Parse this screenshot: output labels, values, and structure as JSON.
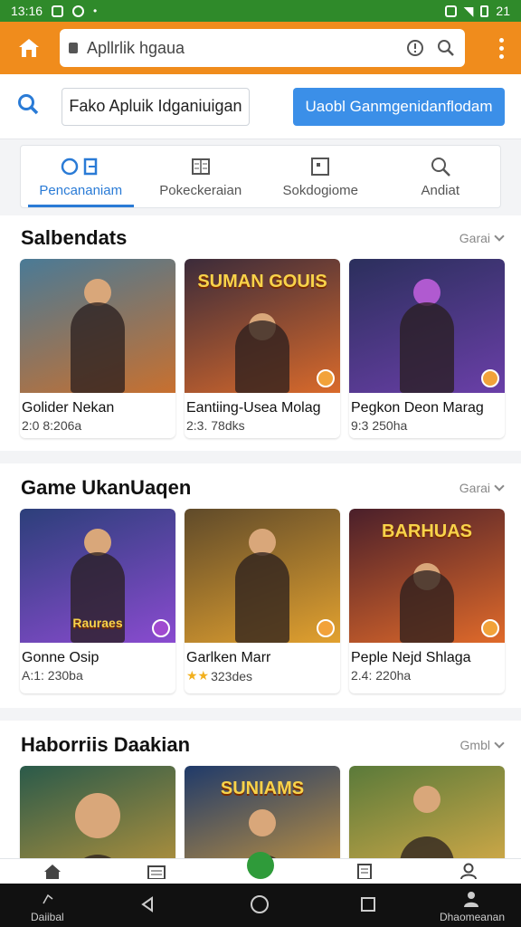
{
  "status_bar": {
    "time": "13:16",
    "battery": "21"
  },
  "app_bar": {
    "url": "Apllrlik hgaua"
  },
  "search": {
    "input_value": "Fako Apluik Idganiuigan",
    "button_label": "Uaobl Ganmgenidanflodam"
  },
  "tabs": [
    {
      "label": "Pencananiam",
      "icon": "tag-icon",
      "active": true
    },
    {
      "label": "Pokeckeraian",
      "icon": "list-icon",
      "active": false
    },
    {
      "label": "Sokdogiome",
      "icon": "grid-icon",
      "active": false
    },
    {
      "label": "Andiat",
      "icon": "search-icon",
      "active": false
    }
  ],
  "sections": [
    {
      "title": "Salbendats",
      "more_label": "Garai",
      "items": [
        {
          "name": "Golider Nekan",
          "meta": "2:0 8:206a",
          "logo": "",
          "colors": [
            "#4a7a96",
            "#c8702f"
          ]
        },
        {
          "name": "Eantiing-Usea Molag",
          "meta": "2:3. 78dks",
          "logo": "SUMAN GOUIS",
          "colors": [
            "#3b2b3a",
            "#d96a2b"
          ]
        },
        {
          "name": "Pegkon Deon Marag",
          "meta": "9:3 250ha",
          "logo": "",
          "colors": [
            "#2b2f5c",
            "#6a3fa8"
          ]
        }
      ]
    },
    {
      "title": "Game UkanUaqen",
      "more_label": "Garai",
      "items": [
        {
          "name": "Gonne Osip",
          "meta": "A:1: 230ba",
          "logo": "Rauraes",
          "colors": [
            "#2c3f7a",
            "#8a4bd0"
          ]
        },
        {
          "name": "Garlken Marr",
          "meta": "323des",
          "stars": "★★",
          "logo": "",
          "colors": [
            "#5f4a2a",
            "#e2a12f"
          ]
        },
        {
          "name": "Peple Nejd Shlaga",
          "meta": "2.4: 220ha",
          "logo": "BARHUAS",
          "colors": [
            "#4a1f2a",
            "#e06a2a"
          ]
        }
      ]
    },
    {
      "title": "Haborriis Daakian",
      "more_label": "Gmbl",
      "items": [
        {
          "name": "",
          "meta": "",
          "logo": "",
          "colors": [
            "#2a5a4a",
            "#c79a3a"
          ]
        },
        {
          "name": "",
          "meta": "",
          "logo": "SUNIAMS",
          "colors": [
            "#1f3a6a",
            "#d9a03a"
          ]
        },
        {
          "name": "",
          "meta": "",
          "logo": "",
          "colors": [
            "#5a7a3a",
            "#e8b24a"
          ]
        }
      ]
    }
  ],
  "bottom_nav": [
    "home-icon",
    "news-icon",
    "play-icon",
    "document-icon",
    "profile-icon"
  ],
  "system_nav": {
    "left_label": "Daiibal",
    "right_label": "Dhaomeanan"
  }
}
